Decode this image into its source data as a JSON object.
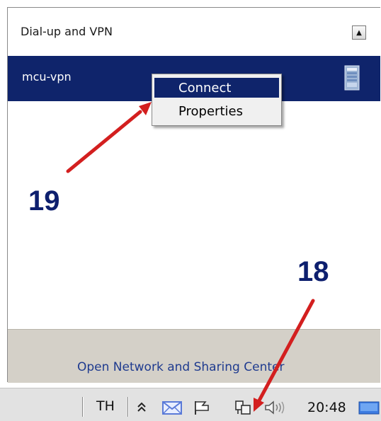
{
  "panel": {
    "section_title": "Dial-up and VPN",
    "collapse_glyph": "▲",
    "connection_name": "mcu-vpn",
    "footer_link": "Open Network and Sharing Center"
  },
  "context_menu": {
    "items": [
      {
        "label": "Connect",
        "selected": true
      },
      {
        "label": "Properties",
        "selected": false
      }
    ]
  },
  "taskbar": {
    "language": "TH",
    "tray_icons": [
      "chevron-up-icon",
      "mail-icon",
      "flag-icon",
      "network-icon",
      "speaker-icon"
    ],
    "clock": "20:48"
  },
  "annotations": {
    "step_19": "19",
    "step_18": "18",
    "arrow_color": "#d31f1f",
    "label_color": "#0d1f6e"
  },
  "colors": {
    "selection": "#0f246b",
    "footer_bg": "#d4d0c8",
    "link": "#1f3b8f"
  }
}
